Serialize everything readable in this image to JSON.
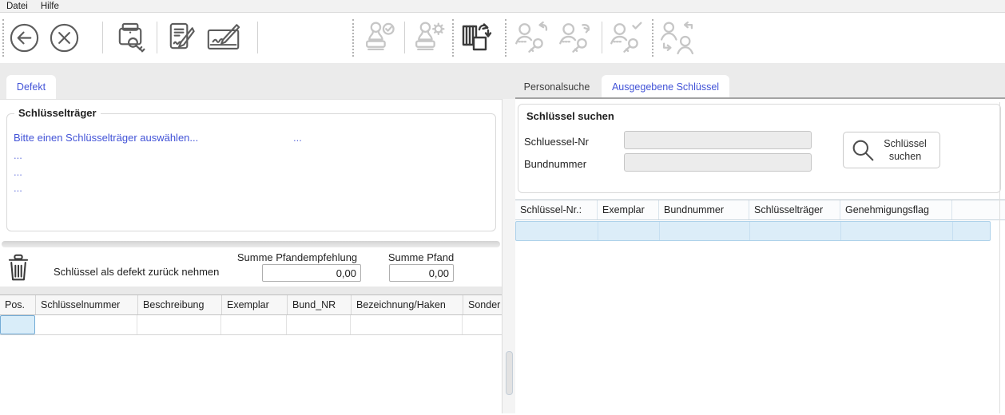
{
  "menu": {
    "items": [
      {
        "label": "Datei"
      },
      {
        "label": "Hilfe"
      }
    ]
  },
  "toolbar": {
    "icons": [
      {
        "name": "back",
        "enabled": true
      },
      {
        "name": "cancel",
        "enabled": true
      },
      {
        "name": "print-key",
        "enabled": true
      },
      {
        "name": "edit-document",
        "enabled": true
      },
      {
        "name": "signature-pad",
        "enabled": true
      },
      {
        "name": "stamp-approve",
        "enabled": false
      },
      {
        "name": "stamp-settings",
        "enabled": false
      },
      {
        "name": "swap-keycards",
        "enabled": true
      },
      {
        "name": "key-return",
        "enabled": false
      },
      {
        "name": "key-issue",
        "enabled": false
      },
      {
        "name": "key-approve",
        "enabled": false
      },
      {
        "name": "person-swap",
        "enabled": false
      }
    ]
  },
  "left_panel": {
    "tab": {
      "label": "Defekt"
    },
    "keyholder_group": {
      "title": "Schlüsselträger",
      "prompt": "Bitte einen Schlüsselträger auswählen...",
      "ellipsis": "...",
      "rows": [
        "...",
        "...",
        "..."
      ]
    },
    "defect_bar": {
      "action_label": "Schlüssel als defekt zurück nehmen",
      "sum_recommendation_label": "Summe Pfandempfehlung",
      "sum_recommendation_value": "0,00",
      "sum_deposit_label": "Summe Pfand",
      "sum_deposit_value": "0,00"
    },
    "table": {
      "columns": [
        "Pos.",
        "Schlüsselnummer",
        "Beschreibung",
        "Exemplar",
        "Bund_NR",
        "Bezeichnung/Haken",
        "Sonder"
      ]
    }
  },
  "right_panel": {
    "tabs": [
      {
        "label": "Personalsuche"
      },
      {
        "label": "Ausgegebene Schlüssel"
      }
    ],
    "search_group": {
      "title": "Schlüssel suchen",
      "key_number_label": "Schluessel-Nr",
      "key_number_value": "",
      "bundle_number_label": "Bundnummer",
      "bundle_number_value": "",
      "search_button": {
        "line1": "Schlüssel",
        "line2": "suchen"
      }
    },
    "table": {
      "columns": [
        "Schlüssel-Nr.:",
        "Exemplar",
        "Bundnummer",
        "Schlüsselträger",
        "Genehmigungsflag"
      ]
    }
  },
  "colors": {
    "accent_blue": "#4253d7",
    "selection_fill": "#dcedf8",
    "selection_border": "#aed2ea",
    "disabled_icon": "#c6c6c6",
    "enabled_icon": "#565656",
    "dark_icon": "#3a3a3a"
  }
}
